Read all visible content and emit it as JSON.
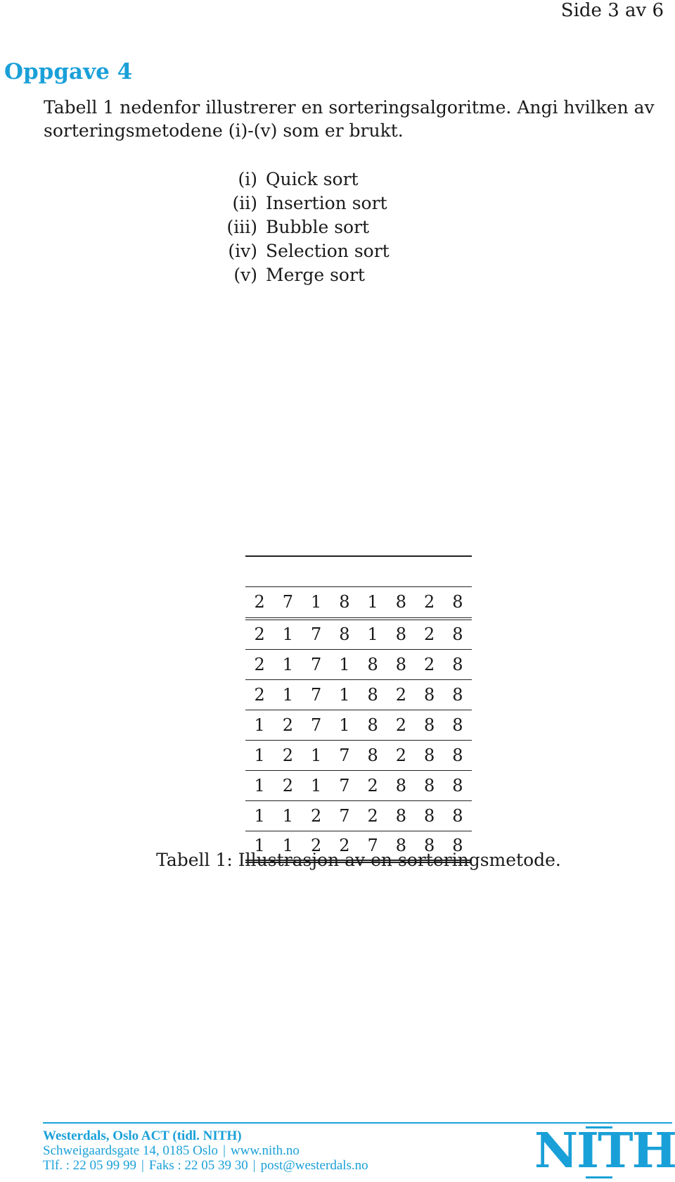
{
  "header": {
    "page_number": "Side 3 av 6"
  },
  "section": {
    "title": "Oppgave 4",
    "intro": "Tabell 1 nedenfor illustrerer en sorteringsalgoritme. Angi hvilken av sorteringsmetodene (i)-(v) som er brukt."
  },
  "options": [
    {
      "num": "(i)",
      "label": "Quick sort"
    },
    {
      "num": "(ii)",
      "label": "Insertion sort"
    },
    {
      "num": "(iii)",
      "label": "Bubble sort"
    },
    {
      "num": "(iv)",
      "label": "Selection sort"
    },
    {
      "num": "(v)",
      "label": "Merge sort"
    }
  ],
  "table": {
    "header_row": [
      "2",
      "7",
      "1",
      "8",
      "1",
      "8",
      "2",
      "8"
    ],
    "rows": [
      [
        "2",
        "1",
        "7",
        "8",
        "1",
        "8",
        "2",
        "8"
      ],
      [
        "2",
        "1",
        "7",
        "1",
        "8",
        "8",
        "2",
        "8"
      ],
      [
        "2",
        "1",
        "7",
        "1",
        "8",
        "2",
        "8",
        "8"
      ],
      [
        "1",
        "2",
        "7",
        "1",
        "8",
        "2",
        "8",
        "8"
      ],
      [
        "1",
        "2",
        "1",
        "7",
        "8",
        "2",
        "8",
        "8"
      ],
      [
        "1",
        "2",
        "1",
        "7",
        "2",
        "8",
        "8",
        "8"
      ],
      [
        "1",
        "1",
        "2",
        "7",
        "2",
        "8",
        "8",
        "8"
      ],
      [
        "1",
        "1",
        "2",
        "2",
        "7",
        "8",
        "8",
        "8"
      ]
    ],
    "caption": "Tabell 1: Illustrasjon av en sorteringsmetode."
  },
  "footer": {
    "org": "Westerdals, Oslo ACT (tidl. NITH)",
    "address": "Schweigaardsgate 14, 0185 Oslo",
    "web": "www.nith.no",
    "phone": "Tlf. : 22 05 99 99",
    "fax": "Faks : 22 05 39 30",
    "email": "post@westerdals.no",
    "separator": "|",
    "logo_text": "NITH"
  },
  "colors": {
    "accent": "#1aa0d8",
    "text": "#1a1a1a"
  }
}
